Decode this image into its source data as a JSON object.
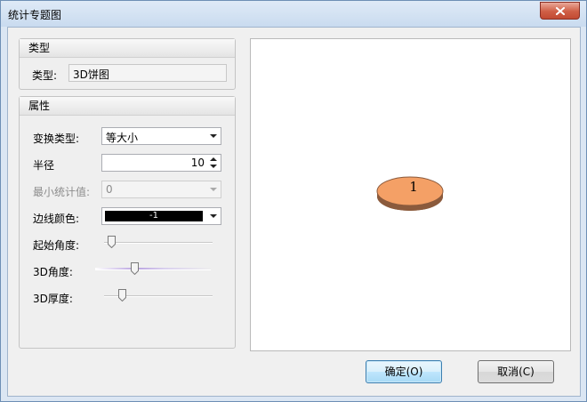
{
  "window": {
    "title": "统计专题图"
  },
  "type_group": {
    "header": "类型",
    "type_label": "类型:",
    "type_value": "3D饼图"
  },
  "props_group": {
    "header": "属性",
    "transform_label": "变换类型:",
    "transform_value": "等大小",
    "radius_label": "半径",
    "radius_value": "10",
    "min_label": "最小统计值:",
    "min_value": "0",
    "edge_color_label": "边线颜色:",
    "edge_color_value": "-1",
    "edge_color_hex": "#000000",
    "start_angle_label": "起始角度:",
    "start_angle_level": 0.0,
    "angle3d_label": "3D角度:",
    "angle3d_level": 0.35,
    "thickness3d_label": "3D厚度:",
    "thickness3d_level": 0.1
  },
  "preview": {
    "slice_label": "1",
    "slice_color": "#f4a066",
    "slice_side_color": "#8b5a3c"
  },
  "buttons": {
    "ok": "确定(O)",
    "cancel": "取消(C)"
  },
  "icons": {
    "close": "close-icon",
    "dropdown": "chevron-down-icon",
    "spin": "spinner-icon"
  }
}
